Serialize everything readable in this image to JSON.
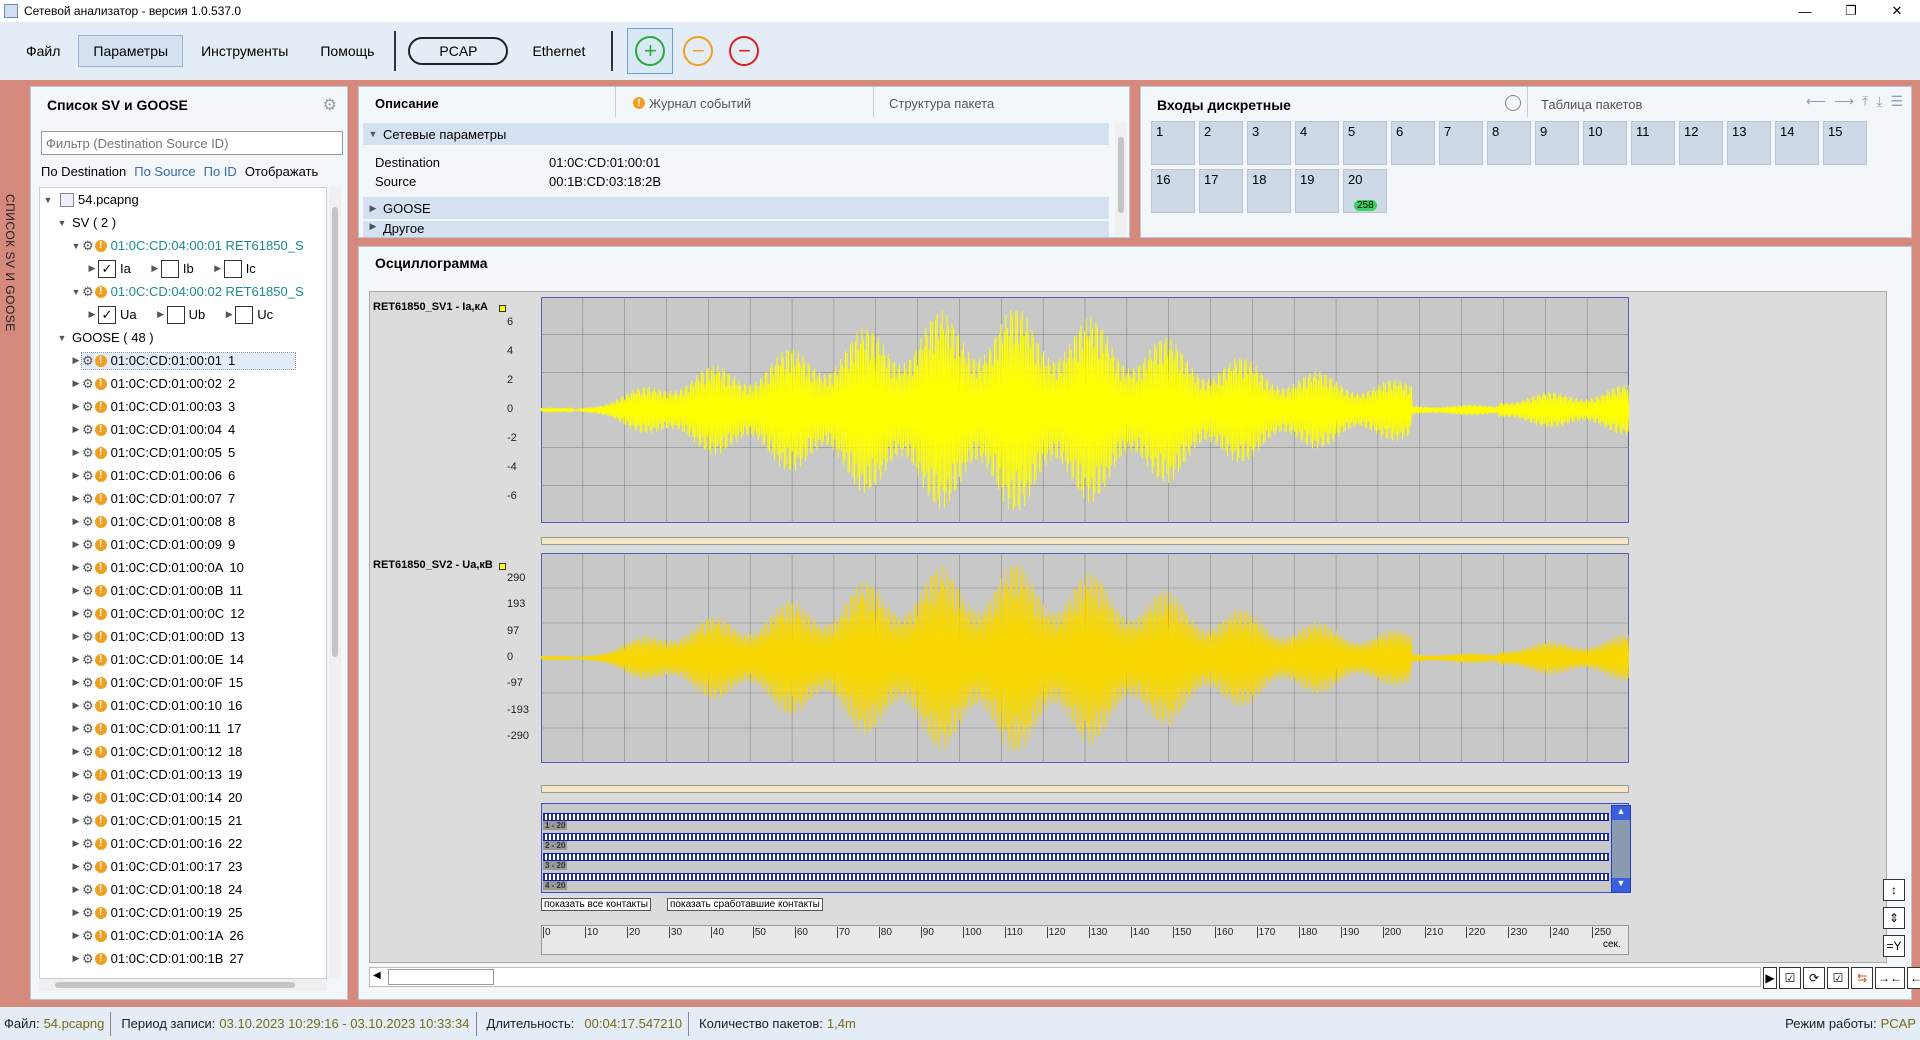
{
  "window": {
    "title": "Сетевой анализатор - версия 1.0.537.0",
    "min": "—",
    "max": "❐",
    "close": "✕"
  },
  "menu": {
    "file": "Файл",
    "params": "Параметры",
    "tools": "Инструменты",
    "help": "Помощь",
    "pcap": "PCAP",
    "ethernet": "Ethernet"
  },
  "side_strip": "СПИСОК SV И GOOSE",
  "left_panel": {
    "title": "Список SV и GOOSE",
    "filter_placeholder": "Фильтр (Destination Source ID)",
    "sort": {
      "dest": "По Destination",
      "source": "По Source",
      "id": "По ID",
      "show": "Отображать"
    },
    "file": "54.pcapng",
    "sv_group": "SV ( 2 )",
    "sv_streams": [
      {
        "label": "01:0C:CD:04:00:01 RET61850_S",
        "channels": [
          {
            "name": "Ia",
            "checked": true
          },
          {
            "name": "Ib",
            "checked": false
          },
          {
            "name": "Ic",
            "checked": false
          }
        ]
      },
      {
        "label": "01:0C:CD:04:00:02 RET61850_S",
        "channels": [
          {
            "name": "Ua",
            "checked": true
          },
          {
            "name": "Ub",
            "checked": false
          },
          {
            "name": "Uc",
            "checked": false
          }
        ]
      }
    ],
    "goose_group": "GOOSE ( 48 )",
    "goose_items": [
      {
        "mac": "01:0C:CD:01:00:01",
        "id": "1"
      },
      {
        "mac": "01:0C:CD:01:00:02",
        "id": "2"
      },
      {
        "mac": "01:0C:CD:01:00:03",
        "id": "3"
      },
      {
        "mac": "01:0C:CD:01:00:04",
        "id": "4"
      },
      {
        "mac": "01:0C:CD:01:00:05",
        "id": "5"
      },
      {
        "mac": "01:0C:CD:01:00:06",
        "id": "6"
      },
      {
        "mac": "01:0C:CD:01:00:07",
        "id": "7"
      },
      {
        "mac": "01:0C:CD:01:00:08",
        "id": "8"
      },
      {
        "mac": "01:0C:CD:01:00:09",
        "id": "9"
      },
      {
        "mac": "01:0C:CD:01:00:0A",
        "id": "10"
      },
      {
        "mac": "01:0C:CD:01:00:0B",
        "id": "11"
      },
      {
        "mac": "01:0C:CD:01:00:0C",
        "id": "12"
      },
      {
        "mac": "01:0C:CD:01:00:0D",
        "id": "13"
      },
      {
        "mac": "01:0C:CD:01:00:0E",
        "id": "14"
      },
      {
        "mac": "01:0C:CD:01:00:0F",
        "id": "15"
      },
      {
        "mac": "01:0C:CD:01:00:10",
        "id": "16"
      },
      {
        "mac": "01:0C:CD:01:00:11",
        "id": "17"
      },
      {
        "mac": "01:0C:CD:01:00:12",
        "id": "18"
      },
      {
        "mac": "01:0C:CD:01:00:13",
        "id": "19"
      },
      {
        "mac": "01:0C:CD:01:00:14",
        "id": "20"
      },
      {
        "mac": "01:0C:CD:01:00:15",
        "id": "21"
      },
      {
        "mac": "01:0C:CD:01:00:16",
        "id": "22"
      },
      {
        "mac": "01:0C:CD:01:00:17",
        "id": "23"
      },
      {
        "mac": "01:0C:CD:01:00:18",
        "id": "24"
      },
      {
        "mac": "01:0C:CD:01:00:19",
        "id": "25"
      },
      {
        "mac": "01:0C:CD:01:00:1A",
        "id": "26"
      },
      {
        "mac": "01:0C:CD:01:00:1B",
        "id": "27"
      }
    ]
  },
  "desc_panel": {
    "tabs": {
      "desc": "Описание",
      "events": "Журнал событий",
      "structure": "Структура пакета"
    },
    "net_params": "Сетевые параметры",
    "dest_label": "Destination",
    "dest_value": "01:0C:CD:01:00:01",
    "src_label": "Source",
    "src_value": "00:1B:CD:03:18:2B",
    "goose": "GOOSE",
    "other": "Другое"
  },
  "discrete_panel": {
    "title": "Входы дискретные",
    "table_title": "Таблица пакетов",
    "inputs": [
      "1",
      "2",
      "3",
      "4",
      "5",
      "6",
      "7",
      "8",
      "9",
      "10",
      "11",
      "12",
      "13",
      "14",
      "15",
      "16",
      "17",
      "18",
      "19",
      "20"
    ],
    "badge": "258"
  },
  "osc": {
    "title": "Осциллограмма",
    "ch1": {
      "label": "RET61850_SV1 - Ia,кA",
      "ticks": [
        "6",
        "4",
        "2",
        "0",
        "-2",
        "-4",
        "-6"
      ]
    },
    "ch2": {
      "label": "RET61850_SV2 - Ua,кВ",
      "ticks": [
        "290",
        "193",
        "97",
        "0",
        "-97",
        "-193",
        "-290"
      ]
    },
    "digital_rows": [
      "1 - 20",
      "2 - 20",
      "3 - 20",
      "4 - 20"
    ],
    "show_all": "показать все контакты",
    "show_triggered": "показать сработавшие контакты",
    "x_ticks": [
      "0",
      "10",
      "20",
      "30",
      "40",
      "50",
      "60",
      "70",
      "80",
      "90",
      "100",
      "110",
      "120",
      "130",
      "140",
      "150",
      "160",
      "170",
      "180",
      "190",
      "200",
      "210",
      "220",
      "230",
      "240",
      "250"
    ],
    "x_unit": "сек."
  },
  "status": {
    "file_label": "Файл:",
    "file_value": "54.pcapng",
    "period_label": "Период записи:",
    "period_value": "03.10.2023 10:29:16 - 03.10.2023 10:33:34",
    "dur_label": "Длительность:",
    "dur_value": "00:04:17.547210",
    "count_label": "Количество пакетов:",
    "count_value": "1,4m",
    "mode_label": "Режим работы:",
    "mode_value": "PCAP"
  }
}
